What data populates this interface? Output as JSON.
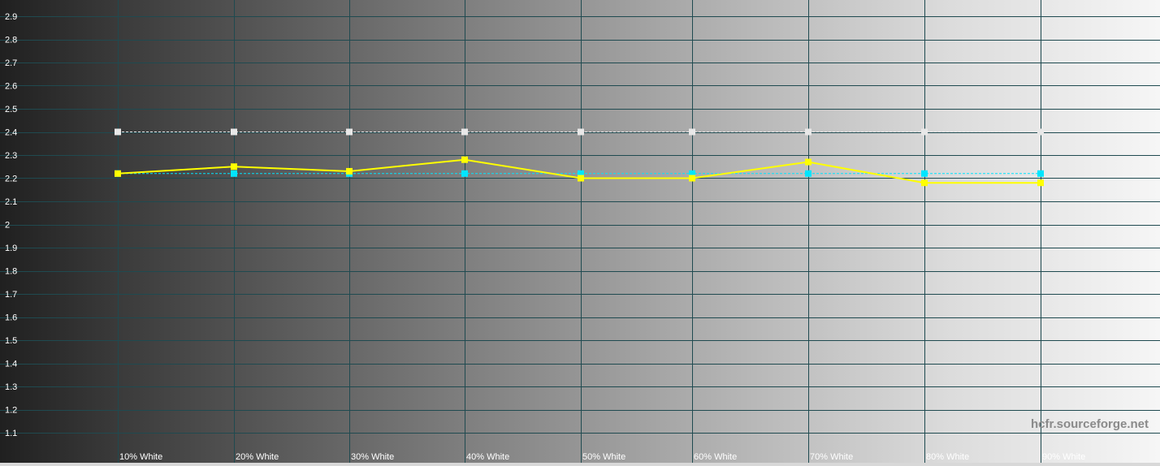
{
  "chart_data": {
    "type": "line",
    "categories": [
      "10% White",
      "20% White",
      "30% White",
      "40% White",
      "50% White",
      "60% White",
      "70% White",
      "80% White",
      "90% White"
    ],
    "ylim": [
      1.0,
      3.0
    ],
    "y_ticks": [
      "1.1",
      "1.2",
      "1.3",
      "1.4",
      "1.5",
      "1.6",
      "1.7",
      "1.8",
      "1.9",
      "2",
      "2.1",
      "2.2",
      "2.3",
      "2.4",
      "2.5",
      "2.6",
      "2.7",
      "2.8",
      "2.9"
    ],
    "grid": true,
    "series": [
      {
        "values": [
          2.22,
          2.25,
          2.23,
          2.28,
          2.2,
          2.2,
          2.27,
          2.18,
          2.18
        ],
        "color": "#ffff00",
        "style": "solid"
      },
      {
        "values": [
          2.22,
          2.22,
          2.22,
          2.22,
          2.22,
          2.22,
          2.22,
          2.22,
          2.22
        ],
        "color": "#00e5ff",
        "style": "dashed"
      },
      {
        "values": [
          2.4,
          2.4,
          2.4,
          2.4,
          2.4,
          2.4,
          2.4,
          2.4,
          2.4
        ],
        "color": "#e8e8e8",
        "style": "dashed"
      }
    ],
    "grid_color": "#1f4a50"
  },
  "watermark": "hcfr.sourceforge.net"
}
